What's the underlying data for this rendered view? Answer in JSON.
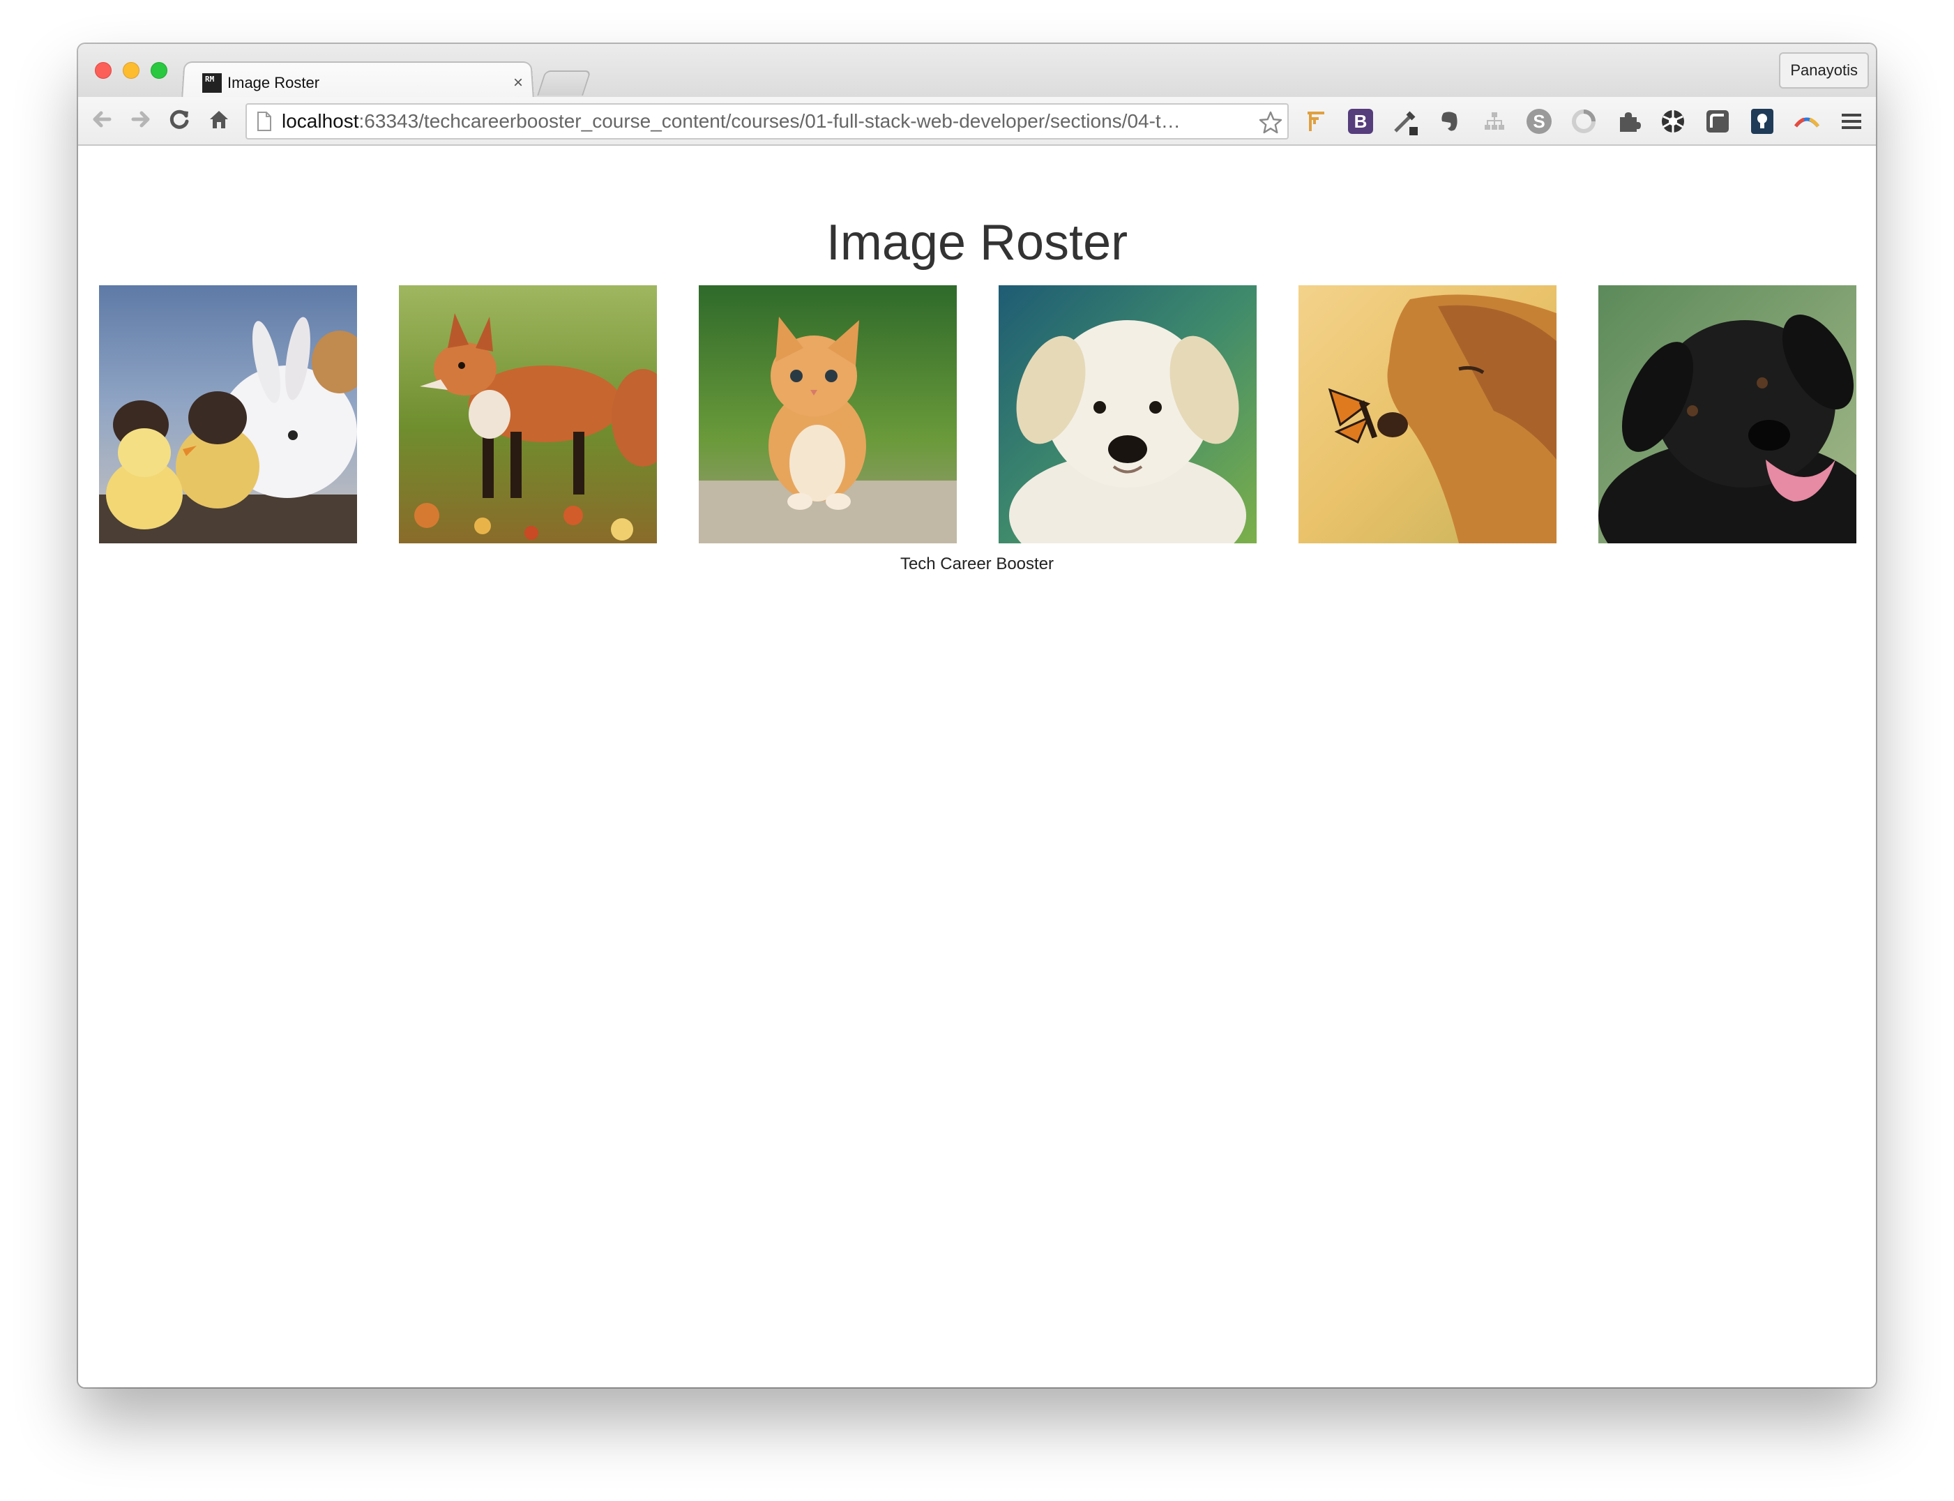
{
  "window": {
    "tab": {
      "title": "Image Roster",
      "favicon_text": "RM",
      "close_glyph": "×"
    },
    "profile_name": "Panayotis"
  },
  "toolbar": {
    "url_host": "localhost",
    "url_rest": ":63343/techcareerbooster_course_content/courses/01-full-stack-web-developer/sections/04-t…",
    "extensions": [
      "bookmark-tree-icon",
      "bootstrap-icon",
      "eyedropper-icon",
      "evernote-icon",
      "sitemap-icon",
      "skype-icon",
      "chrome-swirl-icon",
      "puzzle-icon",
      "aperture-icon",
      "window-icon",
      "lock-keyhole-icon",
      "gradient-arc-icon",
      "menu-icon"
    ],
    "bootstrap_letter": "B",
    "skype_letter": "S"
  },
  "page": {
    "heading": "Image Roster",
    "images": [
      {
        "name": "chicks-and-bunny"
      },
      {
        "name": "red-fox"
      },
      {
        "name": "orange-kitten"
      },
      {
        "name": "white-puppy"
      },
      {
        "name": "golden-retriever-with-butterfly"
      },
      {
        "name": "black-labrador"
      }
    ],
    "footer": "Tech Career Booster"
  }
}
